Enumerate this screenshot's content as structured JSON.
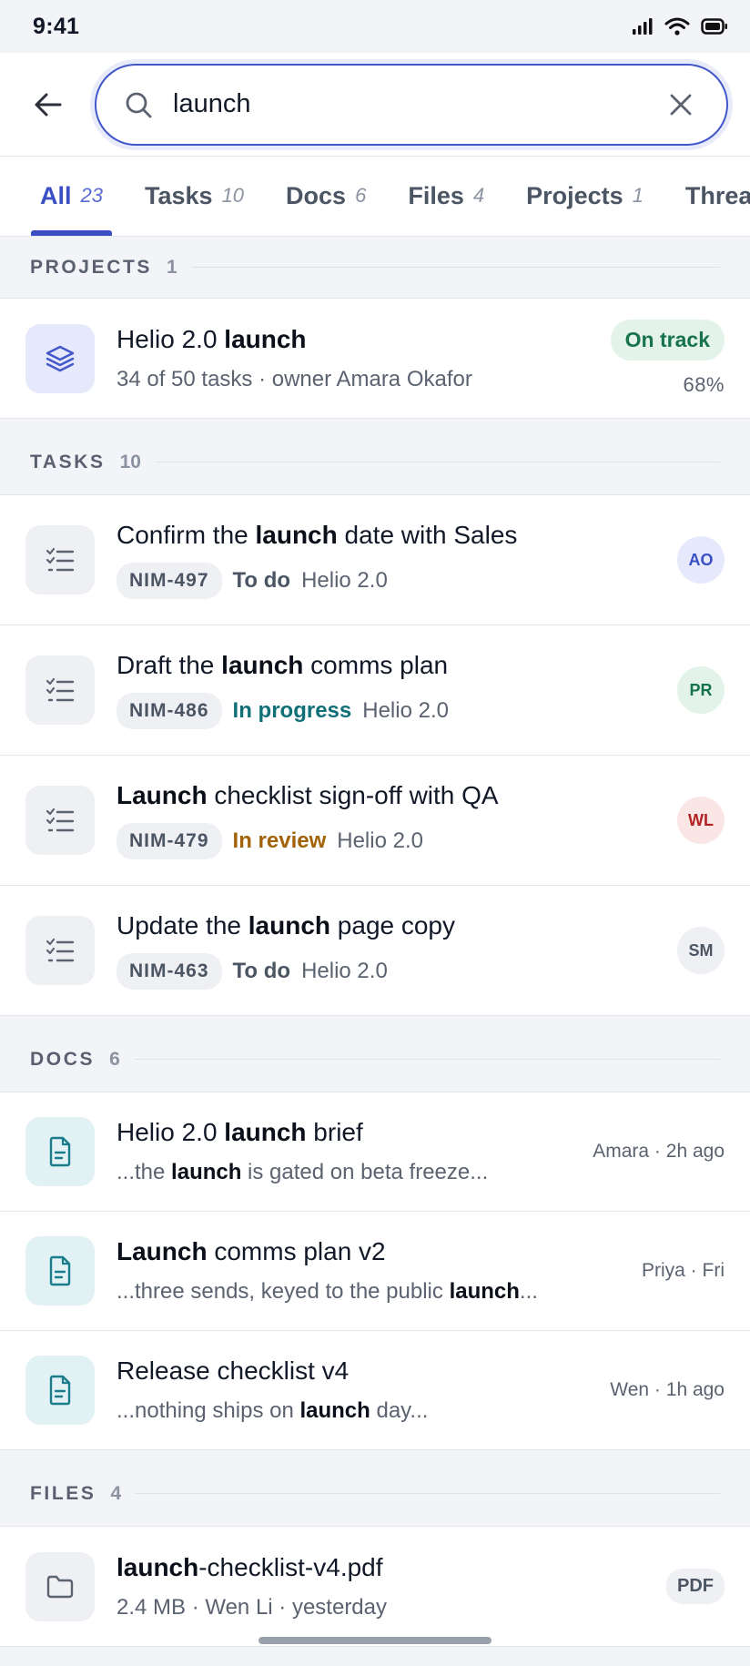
{
  "status_bar": {
    "time": "9:41"
  },
  "search": {
    "query": "launch"
  },
  "tabs": [
    {
      "label": "All",
      "count": "23",
      "active": true
    },
    {
      "label": "Tasks",
      "count": "10"
    },
    {
      "label": "Docs",
      "count": "6"
    },
    {
      "label": "Files",
      "count": "4"
    },
    {
      "label": "Projects",
      "count": "1"
    },
    {
      "label": "Threads",
      "count": ""
    }
  ],
  "sections": {
    "projects": {
      "title": "PROJECTS",
      "count": "1"
    },
    "tasks": {
      "title": "TASKS",
      "count": "10"
    },
    "docs": {
      "title": "DOCS",
      "count": "6"
    },
    "files": {
      "title": "FILES",
      "count": "4"
    }
  },
  "projects": [
    {
      "title_html": "Helio 2.0 <b>launch</b>",
      "subtitle": "34 of 50 tasks · owner Amara Okafor",
      "status": "On track",
      "percent": "68%"
    }
  ],
  "tasks": [
    {
      "title_html": "Confirm the <b>launch</b> date with Sales",
      "id": "NIM-497",
      "status": "To do",
      "status_kind": "todo",
      "project": "Helio 2.0",
      "assignee": "AO",
      "avatar_bg": "#e6e9fb",
      "avatar_fg": "#3b4fc4"
    },
    {
      "title_html": "Draft the <b>launch</b> comms plan",
      "id": "NIM-486",
      "status": "In progress",
      "status_kind": "progress",
      "project": "Helio 2.0",
      "assignee": "PR",
      "avatar_bg": "#e3f3ea",
      "avatar_fg": "#17734a"
    },
    {
      "title_html": "<b>Launch</b> checklist sign-off with QA",
      "id": "NIM-479",
      "status": "In review",
      "status_kind": "review",
      "project": "Helio 2.0",
      "assignee": "WL",
      "avatar_bg": "#fbe6e6",
      "avatar_fg": "#b42323"
    },
    {
      "title_html": "Update the <b>launch</b> page copy",
      "id": "NIM-463",
      "status": "To do",
      "status_kind": "todo",
      "project": "Helio 2.0",
      "assignee": "SM",
      "avatar_bg": "#eef0f3",
      "avatar_fg": "#4b5563"
    }
  ],
  "docs": [
    {
      "title_html": "Helio 2.0 <b>launch</b> brief",
      "snippet_html": "...the <b>launch</b> is gated on beta freeze...",
      "meta": "Amara · 2h ago"
    },
    {
      "title_html": "<b>Launch</b> comms plan v2",
      "snippet_html": "...three sends, keyed to the public <b>launch</b>...",
      "meta": "Priya · Fri"
    },
    {
      "title_html": "Release checklist v4",
      "snippet_html": "...nothing ships on <b>launch</b> day...",
      "meta": "Wen · 1h ago"
    }
  ],
  "files": [
    {
      "title_html": "<b>launch</b>-checklist-v4.pdf",
      "subtitle": "2.4 MB · Wen Li · yesterday",
      "type": "PDF"
    }
  ],
  "colors": {
    "accent": "#3b4fc4",
    "on_track": "#17734a",
    "in_progress": "#0f7077",
    "in_review": "#a26207"
  }
}
